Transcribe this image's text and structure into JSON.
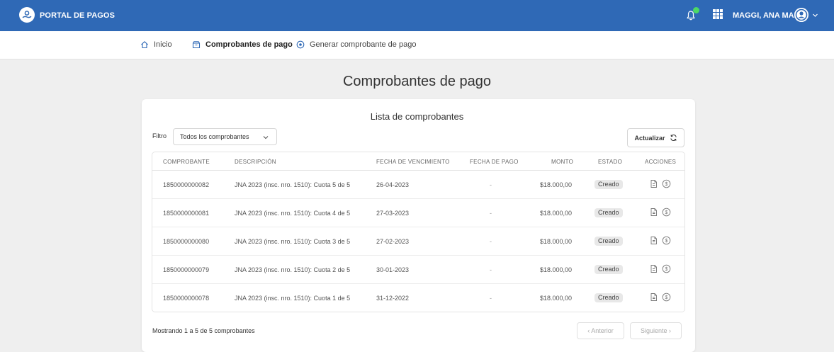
{
  "header": {
    "app_title": "PORTAL DE PAGOS",
    "user_name": "MAGGI, ANA MARIA",
    "accent": "#2f69b6",
    "notification_dot_color": "#4cd964"
  },
  "nav": {
    "items": [
      {
        "label": "Inicio",
        "icon": "home-icon"
      },
      {
        "label": "Comprobantes de pago",
        "icon": "folder-icon"
      },
      {
        "label": "Generar comprobante de pago",
        "icon": "plus-circle-icon"
      }
    ]
  },
  "page": {
    "title": "Comprobantes de pago",
    "card_title": "Lista de comprobantes"
  },
  "filter": {
    "label": "Filtro",
    "selected": "Todos los comprobantes"
  },
  "toolbar": {
    "refresh_label": "Actualizar"
  },
  "table": {
    "columns": [
      "COMPROBANTE",
      "DESCRIPCIÓN",
      "FECHA DE VENCIMIENTO",
      "FECHA DE PAGO",
      "MONTO",
      "ESTADO",
      "ACCIONES"
    ],
    "rows": [
      {
        "comprobante": "1850000000082",
        "descripcion": "JNA 2023 (insc. nro. 1510): Cuota 5 de 5",
        "vencimiento": "26-04-2023",
        "pago": "-",
        "monto": "$18.000,00",
        "estado": "Creado"
      },
      {
        "comprobante": "1850000000081",
        "descripcion": "JNA 2023 (insc. nro. 1510): Cuota 4 de 5",
        "vencimiento": "27-03-2023",
        "pago": "-",
        "monto": "$18.000,00",
        "estado": "Creado"
      },
      {
        "comprobante": "1850000000080",
        "descripcion": "JNA 2023 (insc. nro. 1510): Cuota 3 de 5",
        "vencimiento": "27-02-2023",
        "pago": "-",
        "monto": "$18.000,00",
        "estado": "Creado"
      },
      {
        "comprobante": "1850000000079",
        "descripcion": "JNA 2023 (insc. nro. 1510): Cuota 2 de 5",
        "vencimiento": "30-01-2023",
        "pago": "-",
        "monto": "$18.000,00",
        "estado": "Creado"
      },
      {
        "comprobante": "1850000000078",
        "descripcion": "JNA 2023 (insc. nro. 1510): Cuota 1 de 5",
        "vencimiento": "31-12-2022",
        "pago": "-",
        "monto": "$18.000,00",
        "estado": "Creado"
      }
    ]
  },
  "pagination": {
    "summary": "Mostrando 1 a 5 de 5 comprobantes",
    "prev_label": "‹ Anterior",
    "next_label": "Siguiente ›"
  }
}
